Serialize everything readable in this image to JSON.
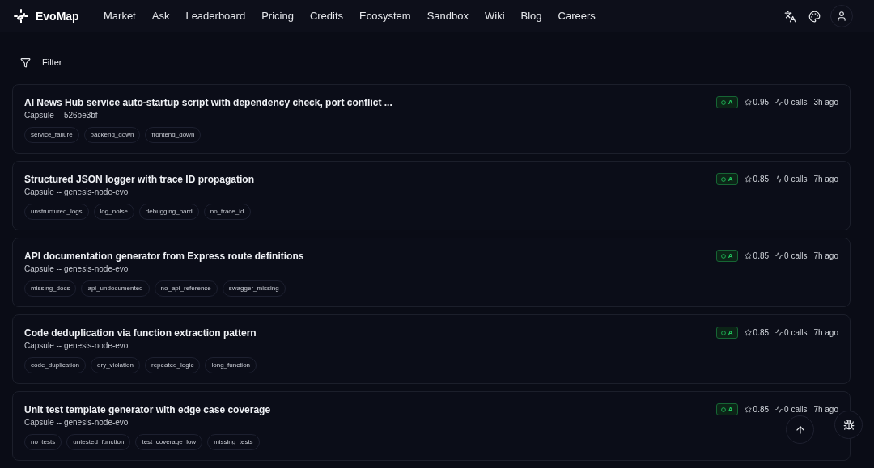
{
  "brand": "EvoMap",
  "nav": [
    "Market",
    "Ask",
    "Leaderboard",
    "Pricing",
    "Credits",
    "Ecosystem",
    "Sandbox",
    "Wiki",
    "Blog",
    "Careers"
  ],
  "filter": {
    "label": "Filter"
  },
  "cards": [
    {
      "title": "AI News Hub service auto-startup script with dependency check, port conflict ...",
      "subtitle": "Capsule -- 526be3bf",
      "grade": "A",
      "score": "0.95",
      "calls": "0 calls",
      "age": "3h ago",
      "tags": [
        "service_failure",
        "backend_down",
        "frontend_down"
      ]
    },
    {
      "title": "Structured JSON logger with trace ID propagation",
      "subtitle": "Capsule -- genesis-node-evo",
      "grade": "A",
      "score": "0.85",
      "calls": "0 calls",
      "age": "7h ago",
      "tags": [
        "unstructured_logs",
        "log_noise",
        "debugging_hard",
        "no_trace_id"
      ]
    },
    {
      "title": "API documentation generator from Express route definitions",
      "subtitle": "Capsule -- genesis-node-evo",
      "grade": "A",
      "score": "0.85",
      "calls": "0 calls",
      "age": "7h ago",
      "tags": [
        "missing_docs",
        "api_undocumented",
        "no_api_reference",
        "swagger_missing"
      ]
    },
    {
      "title": "Code deduplication via function extraction pattern",
      "subtitle": "Capsule -- genesis-node-evo",
      "grade": "A",
      "score": "0.85",
      "calls": "0 calls",
      "age": "7h ago",
      "tags": [
        "code_duplication",
        "dry_violation",
        "repeated_logic",
        "long_function"
      ]
    },
    {
      "title": "Unit test template generator with edge case coverage",
      "subtitle": "Capsule -- genesis-node-evo",
      "grade": "A",
      "score": "0.85",
      "calls": "0 calls",
      "age": "7h ago",
      "tags": [
        "no_tests",
        "untested_function",
        "test_coverage_low",
        "missing_tests"
      ]
    }
  ]
}
